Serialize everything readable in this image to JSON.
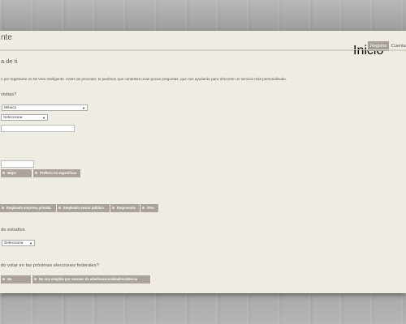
{
  "site": {
    "title_fragment": "nte"
  },
  "nav": {
    "items": [
      "Inicio",
      "Registro",
      "Cuenta"
    ]
  },
  "page": {
    "section_title": "a de ti",
    "intro": "s por registrarte en Mi Voto Inteligente. Antes de proceder, te pedimos que contestes unas pocas preguntas, que nos ayudarán para ofrecerte un servicio más personalizado."
  },
  "form": {
    "q_visits": "visitas?",
    "country_select": "México",
    "state_select": "Selecciona",
    "gender_options": [
      "Mujer",
      "Prefiero no especificar"
    ],
    "occupation_options": [
      "Empleado empresa privada",
      "Empleado sector público",
      "Empresario",
      "Otro"
    ],
    "q_studies": "de estudios",
    "studies_select": "Selecciona",
    "q_vote": "do votar en las próximas elecciones federales?",
    "vote_options": [
      "No",
      "No soy elegible por razones de edad/nacionalidad/residencia"
    ]
  }
}
